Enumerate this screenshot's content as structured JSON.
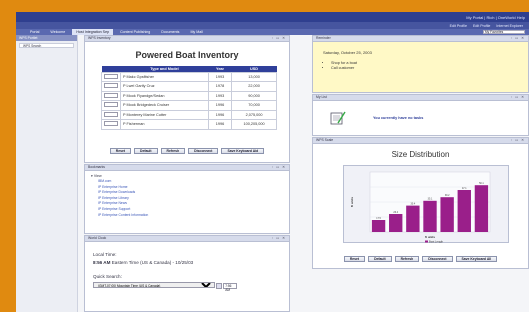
{
  "header": {
    "user": "My Portal | Rich | OneWorld Help",
    "utility": [
      "Edit Profile",
      "Edit Profile",
      "Internet Explorer"
    ],
    "tabs": [
      {
        "label": "Portal",
        "active": false
      },
      {
        "label": "Welcome",
        "active": false
      },
      {
        "label": "Host Integration Sep",
        "active": true
      },
      {
        "label": "Content Publishing",
        "active": false
      },
      {
        "label": "Documents",
        "active": false
      },
      {
        "label": "My Mall",
        "active": false
      }
    ],
    "favorites": "My Favorites"
  },
  "left_nav": {
    "title": "WPS Portlet",
    "items": [
      "WPS Search"
    ]
  },
  "inventory": {
    "header": "WPS Inventory",
    "title": "Powered Boat Inventory",
    "columns": [
      "Type and Model",
      "Year",
      "USD"
    ],
    "rows": [
      {
        "model": "P Makc Gpsfitsher",
        "year": "1993",
        "usd": "13,000"
      },
      {
        "model": "P Lwel Gartly Cruz",
        "year": "1978",
        "usd": "22,000"
      },
      {
        "model": "P Mook Flyandge/Sedan",
        "year": "1993",
        "usd": "90,000"
      },
      {
        "model": "P Mook Bridgedeck Cruiser",
        "year": "1996",
        "usd": "70,000"
      },
      {
        "model": "P Monterey Marine Cutter",
        "year": "1996",
        "usd": "2,075,000"
      },
      {
        "model": "P Fisherman",
        "year": "1996",
        "usd": "100,205,000"
      }
    ],
    "buttons": [
      "Reset",
      "Default",
      "Refresh",
      "Disconnect",
      "Save Keyboard Aid"
    ]
  },
  "bookmarks": {
    "header": "Bookmarks",
    "root": "View",
    "links": [
      "IBM.com",
      "IP Enterprise Home",
      "IP Enterprise Downloads",
      "IP Enterprise Library",
      "IP Enterprise News",
      "IP Enterprise Support",
      "IP Enterprise Content Information"
    ]
  },
  "world_clock": {
    "header": "World Clock",
    "local_time_label": "Local Time:",
    "local_time_bold": "8:56 AM",
    "local_time_rest": "Eastern Time (US & Canada) - 10/25/03",
    "quick_search_label": "Quick Search:",
    "zone_select": "(GMT-07:00) Mountain Time (US & Canada)",
    "time_value": "7:56 AM"
  },
  "reminder": {
    "header": "Reminder",
    "date": "Saturday, October 25, 2003",
    "items": [
      "Shop for a boat",
      "Call customer"
    ]
  },
  "my_list": {
    "header": "My List",
    "message": "You currently have no tasks"
  },
  "size_chart": {
    "header": "WPS Scale",
    "buttons": [
      "Reset",
      "Default",
      "Refresh",
      "Disconnect",
      "Save Keyboard All"
    ]
  },
  "chart_data": {
    "type": "bar",
    "title": "Size Distribution",
    "xlabel": "ft units",
    "ylabel": "ft units",
    "legend": [
      "Boat Length"
    ],
    "categories": [
      "1",
      "2",
      "3",
      "4",
      "5",
      "6",
      "7"
    ],
    "values": [
      20,
      30,
      44,
      52,
      58,
      70,
      78
    ],
    "data_labels": [
      "17.5",
      "26.4",
      "30.4",
      "35.1",
      "39.2",
      "47.1",
      "50.1"
    ],
    "ylim": [
      0,
      100
    ],
    "bar_color": "#9a1f8a"
  }
}
